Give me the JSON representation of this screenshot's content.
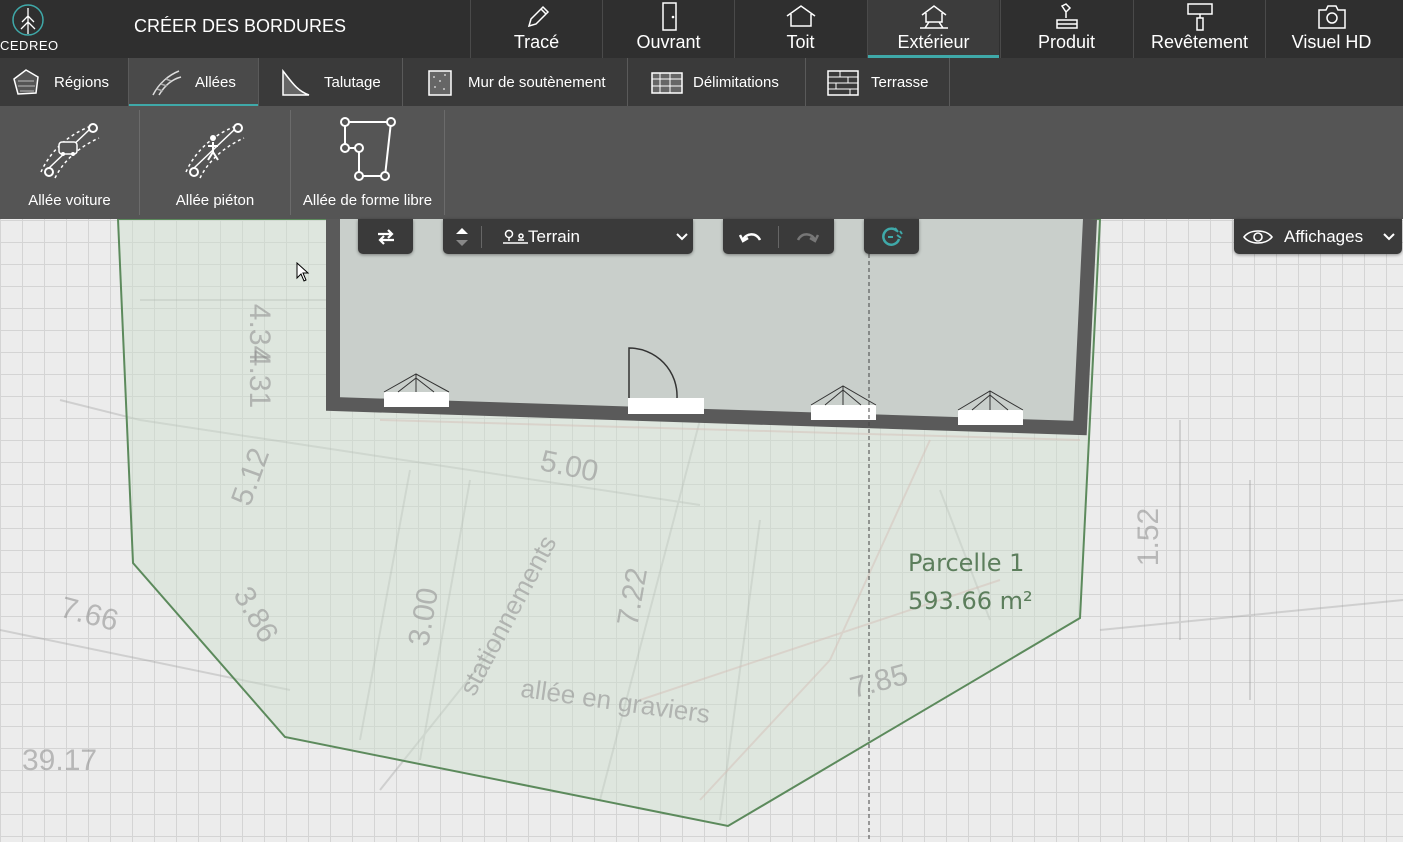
{
  "app": {
    "logo_text": "CEDREO",
    "mode_title": "CRÉER DES BORDURES"
  },
  "main_tabs": [
    {
      "label": "Tracé",
      "icon": "pencil-icon"
    },
    {
      "label": "Ouvrant",
      "icon": "door-icon"
    },
    {
      "label": "Toit",
      "icon": "roof-icon"
    },
    {
      "label": "Extérieur",
      "icon": "exterior-icon",
      "active": true
    },
    {
      "label": "Produit",
      "icon": "product-icon"
    },
    {
      "label": "Revêtement",
      "icon": "paint-roller-icon"
    },
    {
      "label": "Visuel HD",
      "icon": "camera-icon"
    }
  ],
  "sub_tabs": [
    {
      "label": "Régions",
      "icon": "region-icon"
    },
    {
      "label": "Allées",
      "icon": "path-icon",
      "active": true
    },
    {
      "label": "Talutage",
      "icon": "slope-icon"
    },
    {
      "label": "Mur de soutènement",
      "icon": "retaining-wall-icon"
    },
    {
      "label": "Délimitations",
      "icon": "fence-icon"
    },
    {
      "label": "Terrasse",
      "icon": "terrace-icon"
    }
  ],
  "tools": [
    {
      "label": "Allée voiture",
      "icon": "car-path-icon"
    },
    {
      "label": "Allée piéton",
      "icon": "pedestrian-path-icon"
    },
    {
      "label": "Allée de forme libre",
      "icon": "freeform-path-icon"
    }
  ],
  "toolbar": {
    "level_dropdown_label": "Terrain",
    "display_label": "Affichages"
  },
  "parcel": {
    "name": "Parcelle 1",
    "area": "593.66 m²"
  },
  "plan_annotations": [
    "4.34",
    "4.31",
    "5.00",
    "5.12",
    "3.00",
    "7.66",
    "3.86",
    "7.22",
    "1.52",
    "7.85",
    "39.17",
    "stationnements",
    "allée en graviers"
  ],
  "colors": {
    "accent": "#3fa9a9",
    "topbar": "#2f2f2f",
    "parcel_stroke": "#5c8a5c",
    "parcel_fill": "#cfe0cf"
  }
}
